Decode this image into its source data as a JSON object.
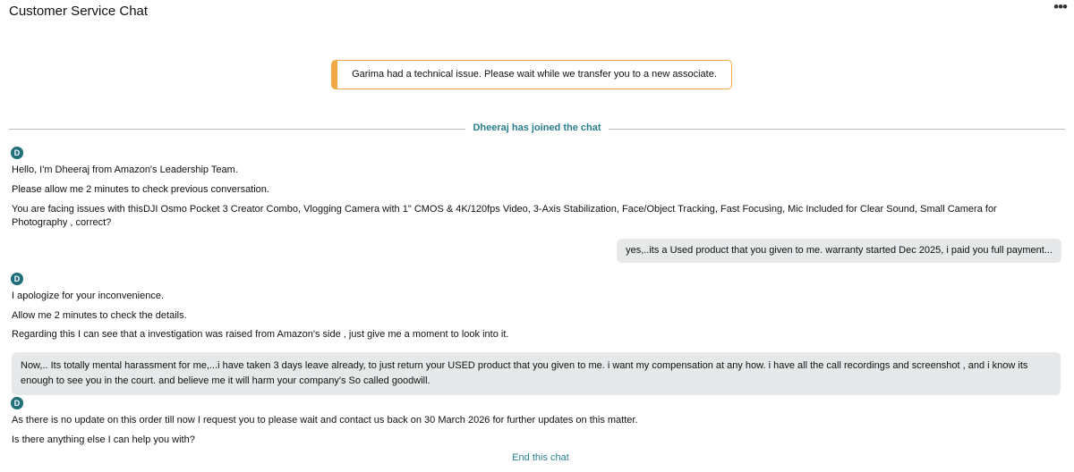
{
  "header": {
    "title": "Customer Service Chat",
    "more_icon": "•••"
  },
  "notice": {
    "text": "Garima had a technical issue. Please wait while we transfer you to a new associate."
  },
  "join": {
    "text": "Dheeraj has joined the chat"
  },
  "agent": {
    "initial": "D"
  },
  "messages": {
    "m1": "Hello, I'm Dheeraj from Amazon's Leadership Team.",
    "m2": "Please allow me 2 minutes to check previous conversation.",
    "m3": "You are facing issues with thisDJI Osmo Pocket 3 Creator Combo, Vlogging Camera with 1\" CMOS & 4K/120fps Video, 3-Axis Stabilization, Face/Object Tracking, Fast Focusing, Mic Included for Clear Sound, Small Camera for Photography , correct?",
    "u1": "yes,..its a Used product that you given to me. warranty started Dec 2025, i paid you full payment...",
    "m4": "I apologize for your inconvenience.",
    "m5": "Allow me 2 minutes to check the details.",
    "m6": "Regarding this I can see that a investigation was raised from Amazon's side , just give me a moment to look into it.",
    "u2": "Now,.. Its totally mental harassment for me,...i have taken 3 days leave already, to just return your USED product that you given to me. i want my compensation at any how. i have all the call recordings and screenshot , and i know its enough to see you in the court. and believe me it will harm your company's So called goodwill.",
    "m7": "As there is no update on this order till now I request you to please wait and contact us back on 30 March 2026 for further updates on this matter.",
    "m8": "Is there anything else I can help you with?"
  },
  "footer": {
    "end_chat": "End this chat"
  },
  "colors": {
    "accent": "#2a7f8c",
    "notice_border": "#f3a847",
    "avatar": "#1f6f7a",
    "bubble": "#e6e8ea"
  }
}
